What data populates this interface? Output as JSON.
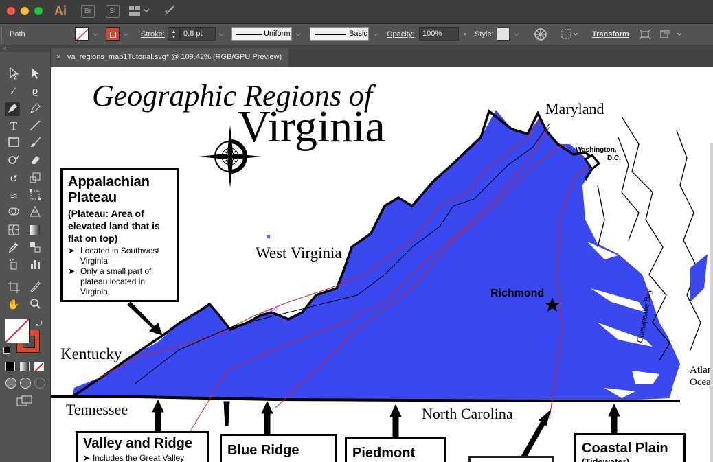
{
  "app": {
    "logo": "Ai",
    "bridge": "Br",
    "stock": "St"
  },
  "control": {
    "selection": "Path",
    "stroke_label": "Stroke:",
    "stroke_value": "0.8 pt",
    "profile": "Uniform",
    "brush": "Basic",
    "opacity_label": "Opacity:",
    "opacity_value": "100%",
    "style_label": "Style:",
    "transform": "Transform"
  },
  "document": {
    "tab_title": "va_regions_map1Tutorial.svg* @ 109.42% (RGB/GPU Preview)",
    "close": "×"
  },
  "map": {
    "title_line1": "Geographic Regions of",
    "title_line2": "Virginia",
    "places": {
      "maryland": "Maryland",
      "washington": "Washington,",
      "dc": "D.C.",
      "west_virginia": "West Virginia",
      "richmond": "Richmond",
      "kentucky": "Kentucky",
      "tennessee": "Tennessee",
      "north_carolina": "North Carolina",
      "chesapeake_bay": "Chesapeake Bay",
      "atlantic1": "Atlan",
      "atlantic2": "Ocea"
    },
    "path_hint": "path",
    "regions": {
      "appalachian_title1": "Appalachian",
      "appalachian_title2": "Plateau",
      "appalachian_desc": "(Plateau: Area of elevated land that is flat on top)",
      "appalachian_bullets": [
        "Located in Southwest Virginia",
        "Only a small part of plateau located in Virginia"
      ],
      "valley_ridge_title": "Valley and Ridge",
      "valley_ridge_bullet": "Includes the Great Valley",
      "blue_ridge_title": "Blue Ridge",
      "piedmont_title": "Piedmont",
      "coastal_plain_title": "Coastal Plain",
      "coastal_plain_sub": "(Tidewater)"
    }
  },
  "colors": {
    "region_fill": "#3a48f0",
    "stroke_swatch": "#e0452c",
    "selection_path": "#d81f1f"
  }
}
